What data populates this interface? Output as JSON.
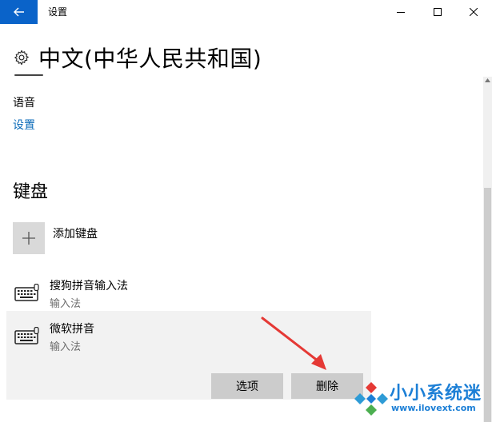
{
  "window": {
    "title": "设置"
  },
  "header": {
    "title": "中文(中华人民共和国)"
  },
  "speech": {
    "label": "语音",
    "link": "设置"
  },
  "keyboards": {
    "heading": "键盘",
    "add_label": "添加键盘",
    "items": [
      {
        "name": "搜狗拼音输入法",
        "type": "输入法"
      },
      {
        "name": "微软拼音",
        "type": "输入法"
      }
    ],
    "options_button": "选项",
    "remove_button": "删除"
  },
  "watermark": {
    "brand": "小小系统迷",
    "url": "www.ilovext.com"
  },
  "colors": {
    "accent": "#0a63c9",
    "link": "#0a6ab8",
    "arrow": "#e53935",
    "selected_bg": "#f2f2f2",
    "button_bg": "#cccccc"
  }
}
